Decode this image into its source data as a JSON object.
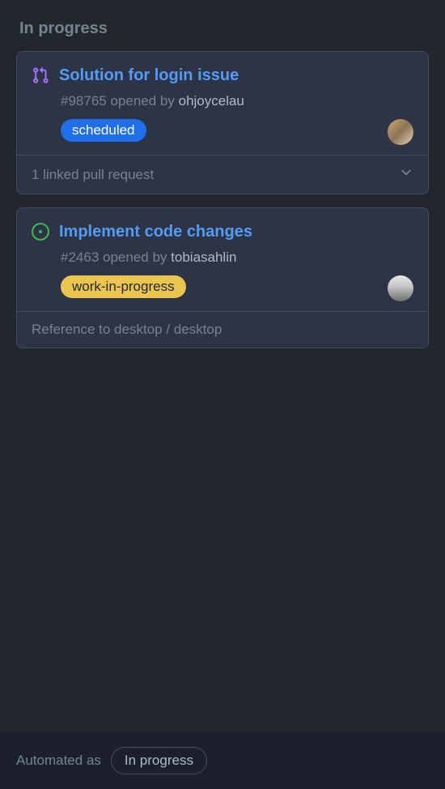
{
  "column": {
    "title": "In progress"
  },
  "cards": [
    {
      "icon": "pull-request",
      "title": "Solution for login issue",
      "number": "#98765",
      "openedText": "opened by",
      "author": "ohjoycelau",
      "label": {
        "text": "scheduled",
        "style": "blue"
      },
      "footer": "1 linked pull request",
      "hasChevron": true
    },
    {
      "icon": "issue-open",
      "title": "Implement code changes",
      "number": "#2463",
      "openedText": "opened by",
      "author": "tobiasahlin",
      "label": {
        "text": "work-in-progress",
        "style": "yellow"
      },
      "footer": "Reference to desktop / desktop",
      "hasChevron": false
    }
  ],
  "bottomBar": {
    "automatedText": "Automated as",
    "status": "In progress"
  }
}
